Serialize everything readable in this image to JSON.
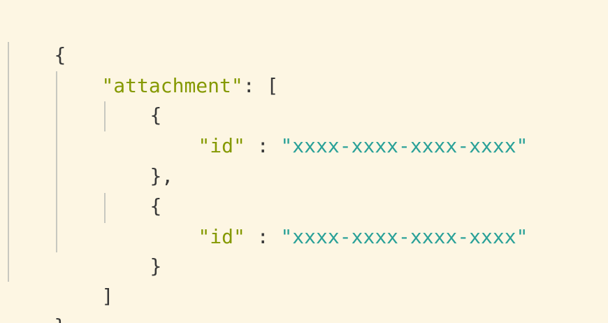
{
  "editor": {
    "lines": [
      {
        "open": "{"
      },
      {
        "key": "\"attachment\"",
        "sep": ": ",
        "bracket": "["
      },
      {
        "open": "{"
      },
      {
        "key": "\"id\"",
        "sep": " : ",
        "value": "\"xxxx-xxxx-xxxx-xxxx\""
      },
      {
        "close": "},"
      },
      {
        "open": "{"
      },
      {
        "key": "\"id\"",
        "sep": " : ",
        "value": "\"xxxx-xxxx-xxxx-xxxx\""
      },
      {
        "close": "}"
      },
      {
        "close": "]"
      },
      {
        "close": "}"
      }
    ]
  },
  "colors": {
    "background": "#fdf6e3",
    "key": "#859900",
    "string": "#2aa198",
    "punctuation": "#383838",
    "indent_guide": "#c8c8c0"
  }
}
